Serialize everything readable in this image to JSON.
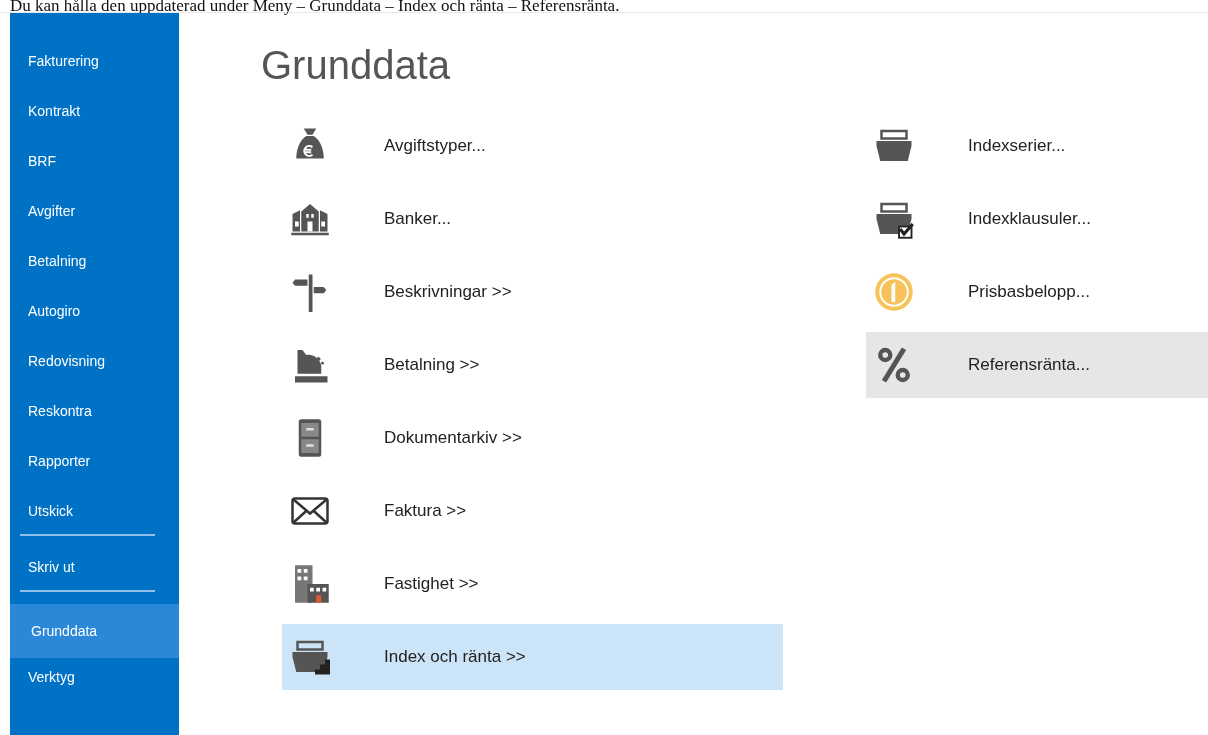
{
  "caption": "Du kan hålla den uppdaterad under Meny – Grunddata – Index och ränta – Referensränta.",
  "sidebar": {
    "groups": [
      {
        "items": [
          {
            "label": "Fakturering",
            "selected": false
          },
          {
            "label": "Kontrakt",
            "selected": false
          },
          {
            "label": "BRF",
            "selected": false
          },
          {
            "label": "Avgifter",
            "selected": false
          },
          {
            "label": "Betalning",
            "selected": false
          },
          {
            "label": "Autogiro",
            "selected": false
          },
          {
            "label": "Redovisning",
            "selected": false
          },
          {
            "label": "Reskontra",
            "selected": false
          },
          {
            "label": "Rapporter",
            "selected": false
          },
          {
            "label": "Utskick",
            "selected": false
          }
        ]
      },
      {
        "items": [
          {
            "label": "Skriv ut",
            "selected": false
          }
        ]
      },
      {
        "items": [
          {
            "label": "Grunddata",
            "selected": true
          },
          {
            "label": "Verktyg",
            "selected": false
          }
        ]
      }
    ]
  },
  "page": {
    "title": "Grunddata",
    "left_items": [
      {
        "label": "Avgiftstyper...",
        "selected": false
      },
      {
        "label": "Banker...",
        "selected": false
      },
      {
        "label": "Beskrivningar >>",
        "selected": false
      },
      {
        "label": "Betalning >>",
        "selected": false
      },
      {
        "label": "Dokumentarkiv >>",
        "selected": false
      },
      {
        "label": "Faktura >>",
        "selected": false
      },
      {
        "label": "Fastighet >>",
        "selected": false
      },
      {
        "label": "Index och ränta >>",
        "selected": true
      }
    ],
    "right_items": [
      {
        "label": "Indexserier...",
        "highlighted": false
      },
      {
        "label": "Indexklausuler...",
        "highlighted": false
      },
      {
        "label": "Prisbasbelopp...",
        "highlighted": false
      },
      {
        "label": "Referensränta...",
        "highlighted": true
      }
    ]
  }
}
